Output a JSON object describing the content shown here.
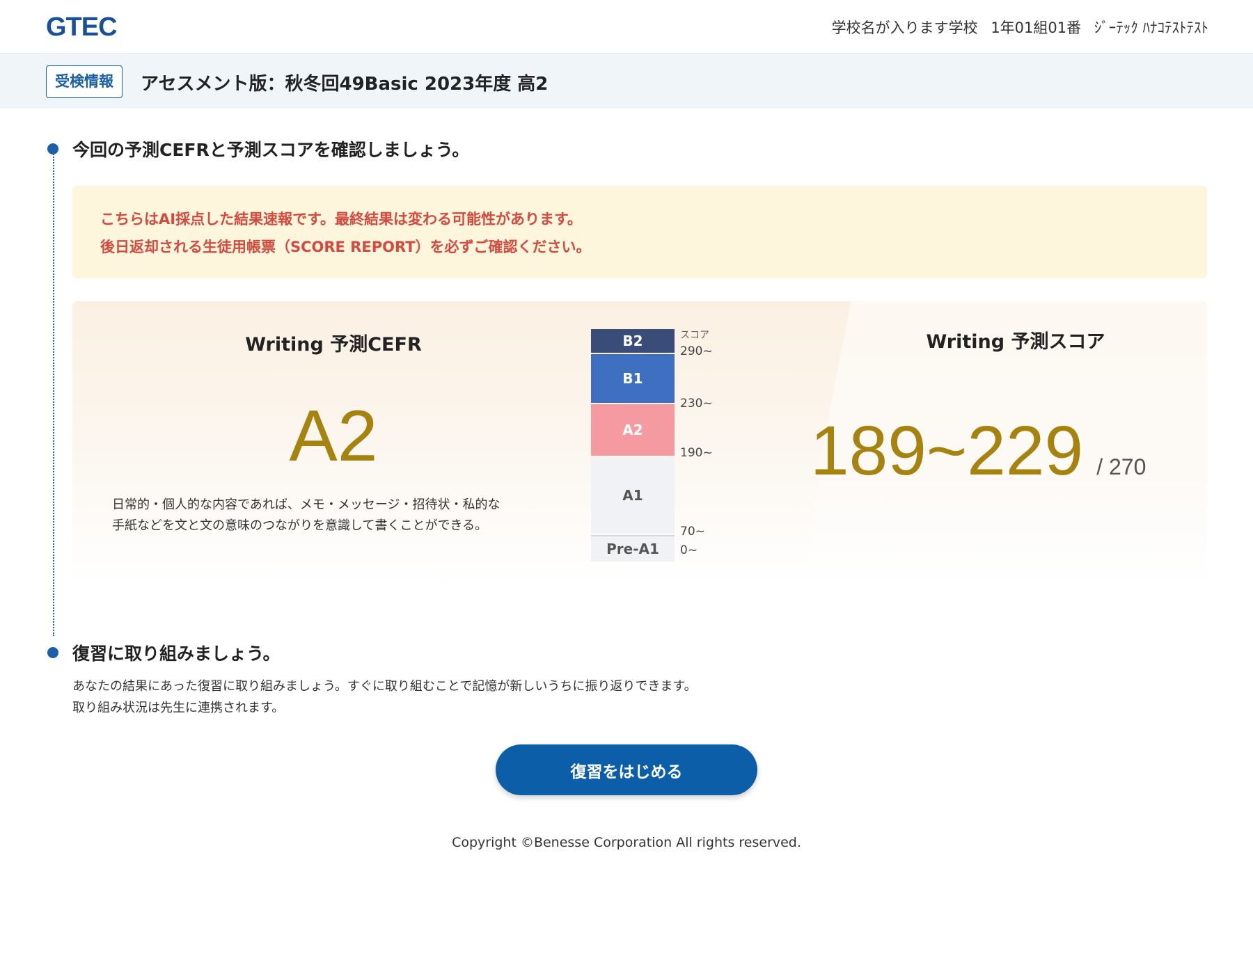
{
  "header": {
    "logo": "GTEC",
    "school": "学校名が入ります学校",
    "class_number": "1年01組01番",
    "student_name": "ｼﾞｰﾃｯｸ ﾊﾅｺﾃｽﾄﾃｽﾄ"
  },
  "exam": {
    "badge": "受検情報",
    "title": "アセスメント版：秋冬回49Basic 2023年度 高2"
  },
  "step1": {
    "title": "今回の予測CEFRと予測スコアを確認しましょう。",
    "notice_line1": "こちらはAI採点した結果速報です。最終結果は変わる可能性があります。",
    "notice_line2": "後日返却される生徒用帳票（SCORE REPORT）を必ずご確認ください。"
  },
  "cefr": {
    "heading": "Writing 予測CEFR",
    "value": "A2",
    "description_line1": "日常的・個人的な内容であれば、メモ・メッセージ・招待状・私的な",
    "description_line2": "手紙などを文と文の意味のつながりを意識して書くことができる。"
  },
  "ladder": {
    "score_label": "スコア",
    "levels": [
      "B2",
      "B1",
      "A2",
      "A1",
      "Pre-A1"
    ],
    "thresholds": [
      "290~",
      "230~",
      "190~",
      "70~",
      "0~"
    ],
    "current_level": "A2",
    "colors": {
      "B2": "#3a4d78",
      "B1": "#3f6fc1",
      "A2": "#f59aa0",
      "A1": "#f1f2f5",
      "Pre-A1": "#f1f2f5"
    }
  },
  "score": {
    "heading": "Writing 予測スコア",
    "range": "189~229",
    "max": "/ 270"
  },
  "step2": {
    "title": "復習に取り組みましょう。",
    "desc_line1": "あなたの結果にあった復習に取り組みましょう。すぐに取り組むことで記憶が新しいうちに振り返りできます。",
    "desc_line2": "取り組み状況は先生に連携されます。",
    "button": "復習をはじめる"
  },
  "footer": {
    "copyright": "Copyright ©Benesse Corporation All rights reserved."
  },
  "colors": {
    "accent": "#1a5fa8",
    "score_gold": "#a6830e",
    "notice_bg": "#fdf6dd",
    "notice_text": "#d44a3f",
    "button_bg": "#0c5ea8"
  }
}
